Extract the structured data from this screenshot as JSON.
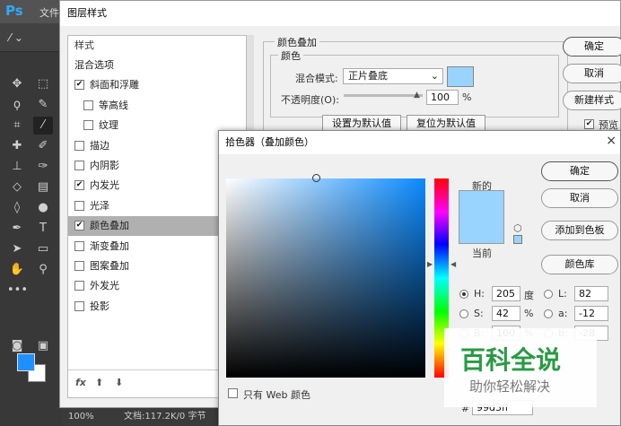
{
  "app": {
    "logo": "Ps",
    "menu_first": "文件"
  },
  "status": {
    "zoom": "100%",
    "doc": "文档:117.2K/0 字节"
  },
  "layer_style": {
    "title": "图层样式",
    "list_header": "样式",
    "items": [
      {
        "label": "混合选项",
        "checkbox": false,
        "checked": false,
        "sel": false,
        "indent": 0
      },
      {
        "label": "斜面和浮雕",
        "checkbox": true,
        "checked": true,
        "sel": false,
        "indent": 0
      },
      {
        "label": "等高线",
        "checkbox": true,
        "checked": false,
        "sel": false,
        "indent": 1
      },
      {
        "label": "纹理",
        "checkbox": true,
        "checked": false,
        "sel": false,
        "indent": 1
      },
      {
        "label": "描边",
        "checkbox": true,
        "checked": false,
        "sel": false,
        "indent": 0
      },
      {
        "label": "内阴影",
        "checkbox": true,
        "checked": false,
        "sel": false,
        "indent": 0
      },
      {
        "label": "内发光",
        "checkbox": true,
        "checked": true,
        "sel": false,
        "indent": 0
      },
      {
        "label": "光泽",
        "checkbox": true,
        "checked": false,
        "sel": false,
        "indent": 0
      },
      {
        "label": "颜色叠加",
        "checkbox": true,
        "checked": true,
        "sel": true,
        "indent": 0
      },
      {
        "label": "渐变叠加",
        "checkbox": true,
        "checked": false,
        "sel": false,
        "indent": 0
      },
      {
        "label": "图案叠加",
        "checkbox": true,
        "checked": false,
        "sel": false,
        "indent": 0
      },
      {
        "label": "外发光",
        "checkbox": true,
        "checked": false,
        "sel": false,
        "indent": 0
      },
      {
        "label": "投影",
        "checkbox": true,
        "checked": false,
        "sel": false,
        "indent": 0
      }
    ],
    "fx": "fx",
    "section_title": "颜色叠加",
    "sub_title": "颜色",
    "blend_label": "混合模式:",
    "blend_value": "正片叠底",
    "opacity_label": "不透明度(O):",
    "opacity_value": "100",
    "opacity_unit": "%",
    "btn_set_default": "设置为默认值",
    "btn_reset_default": "复位为默认值",
    "btn_ok": "确定",
    "btn_cancel": "取消",
    "btn_new_style": "新建样式",
    "preview_label": "预览",
    "overlay_color": "#99d3ff"
  },
  "picker": {
    "title": "拾色器（叠加颜色）",
    "close": "×",
    "new_label": "新的",
    "current_label": "当前",
    "btn_ok": "确定",
    "btn_cancel": "取消",
    "btn_add_swatch": "添加到色板",
    "btn_library": "颜色库",
    "h_label": "H:",
    "h_value": "205",
    "h_unit": "度",
    "s_label": "S:",
    "s_value": "42",
    "s_unit": "%",
    "b_label": "B:",
    "b_value": "100",
    "b_unit": "%",
    "l_label": "L:",
    "l_value": "82",
    "a_label": "a:",
    "a_value": "-12",
    "b2_label": "b:",
    "b2_value": "-28",
    "hex_label": "#",
    "hex_value": "99d3ff",
    "web_only_label": "只有 Web 颜色",
    "hue_color": "#0a8aff"
  },
  "watermark": {
    "main": "百科全说",
    "sub": "助你轻松解决"
  }
}
